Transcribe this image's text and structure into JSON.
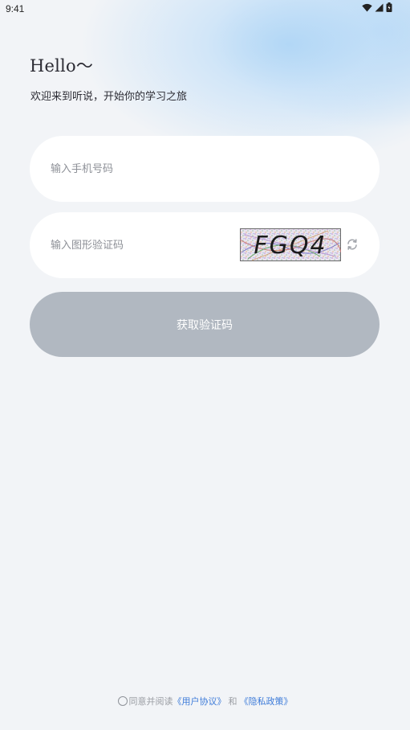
{
  "status_bar": {
    "time": "9:41",
    "icons": [
      "wifi-icon",
      "signal-icon",
      "battery-icon"
    ]
  },
  "greeting": {
    "title": "Hello〜",
    "subtitle": "欢迎来到听说，开始你的学习之旅"
  },
  "form": {
    "phone_placeholder": "输入手机号码",
    "phone_value": "",
    "captcha_placeholder": "输入图形验证码",
    "captcha_value": "",
    "captcha_image_text": "FGQ4",
    "get_code_label": "获取验证码"
  },
  "agreement": {
    "checked": false,
    "prefix": "同意并阅读",
    "user_agreement": "《用户协议》",
    "conjunction": "和",
    "privacy_policy": "《隐私政策》"
  },
  "colors": {
    "background": "#f2f4f7",
    "button_disabled": "#b1b8c1",
    "link": "#3d7bd9"
  }
}
